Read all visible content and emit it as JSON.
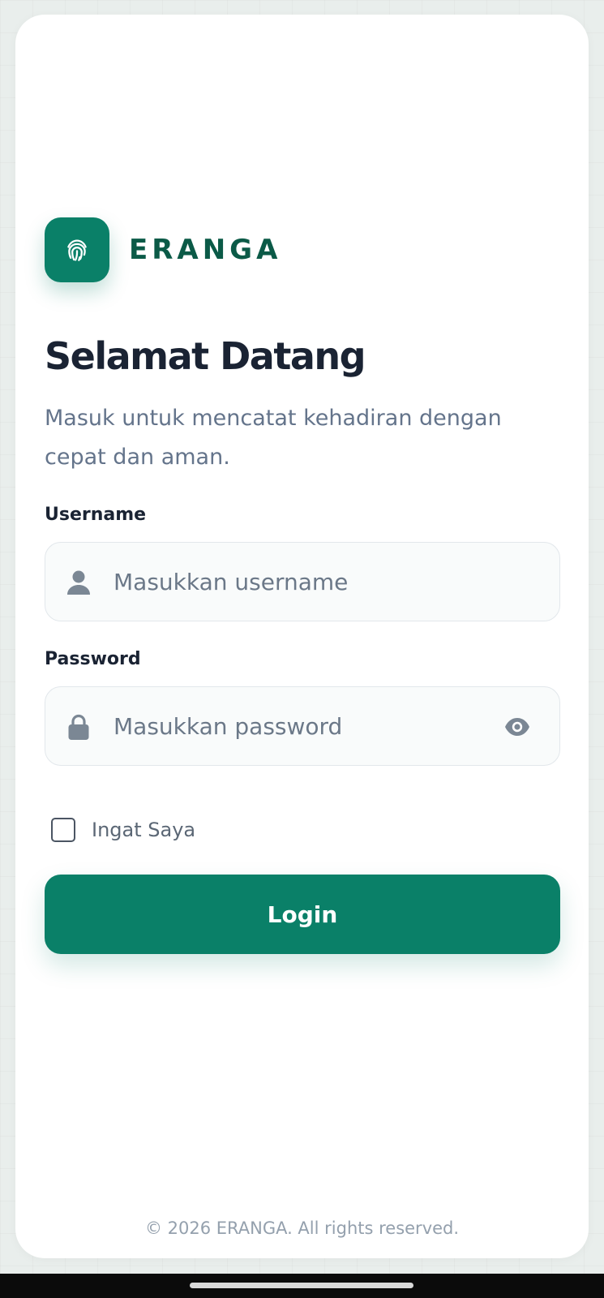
{
  "brand": {
    "name": "ERANGA",
    "logo_icon": "fingerprint-icon",
    "accent_color": "#0a8068"
  },
  "header": {
    "title": "Selamat Datang",
    "subtitle": "Masuk untuk mencatat kehadiran dengan cepat dan aman."
  },
  "form": {
    "username": {
      "label": "Username",
      "placeholder": "Masukkan username",
      "value": "",
      "icon": "user-icon"
    },
    "password": {
      "label": "Password",
      "placeholder": "Masukkan password",
      "value": "",
      "icon": "lock-icon",
      "toggle_icon": "eye-icon"
    },
    "remember": {
      "label": "Ingat Saya",
      "checked": false
    },
    "submit_label": "Login"
  },
  "footer": {
    "text": "© 2026 ERANGA. All rights reserved."
  }
}
